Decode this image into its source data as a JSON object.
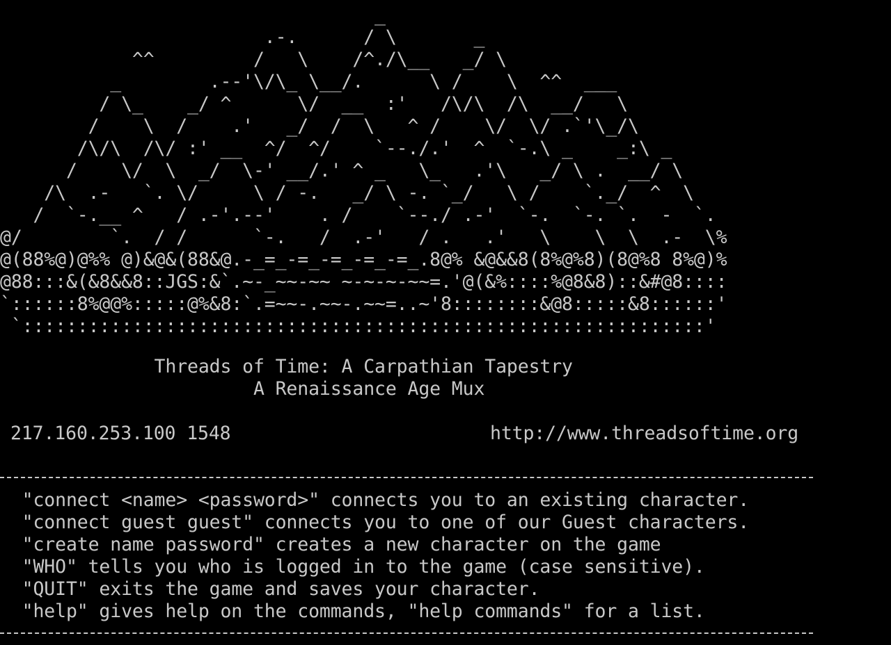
{
  "terminal": {
    "art_lines": [
      "                                  _",
      "                        .-.      / \\       _",
      "            ^^         /   \\    /^./\\__   _/ \\",
      "          _        .--'\\/\\_ \\__/.      \\ /    \\  ^^  ___",
      "         / \\_    _/ ^      \\/  __  :'   /\\/\\  /\\  __/   \\",
      "        /    \\  /    .'   _/  /  \\   ^ /    \\/  \\/ .`'\\_/\\",
      "       /\\/\\  /\\/ :' __  ^/  ^/    `--./.'  ^  `-.\\ _    _:\\ _",
      "      /    \\/  \\  _/  \\-' __/.' ^ _   \\_   .'\\   _/ \\ .  __/ \\",
      "    /\\  .-   `. \\/     \\ / -.   _/ \\ -. `_/   \\ /    `._/  ^  \\",
      "   /  `-.__ ^   / .-'.--'    . /    `--./ .-'  `-.  `-. `.  -  `.",
      "@/        `.  / /      `-.   /  .-'   / .   .'   \\    \\  \\  .-  \\%",
      "@(88%@)@%% @)&@&(88&@.-_=_-=_-=_-=_-=_.8@% &@&&8(8%@%8)(8@%8 8%@)%",
      "@88:::&(&8&&8::JGS:&`.~-_~~-~~ ~-~-~-~~=.'@(&%::::%@8&8)::&#@8::::",
      "`::::::8%@@%:::::@%&8:`.=~~-.~~-.~~=..~'8::::::::&@8:::::&8::::::'",
      " `::::::::::::::::::::::::::::::::::::::::::::::::::::::::::::::'"
    ],
    "title_line": "              Threads of Time: A Carpathian Tapestry",
    "subtitle_line": "                       A Renaissance Age Mux",
    "address": "217.160.253.100 1548",
    "url": "http://www.threadsoftime.org",
    "help_lines": [
      "  \"connect <name> <password>\" connects you to an existing character.",
      "  \"connect guest guest\" connects you to one of our Guest characters.",
      "  \"create name password\" creates a new character on the game",
      "  \"WHO\" tells you who is logged in to the game (case sensitive).",
      "  \"QUIT\" exits the game and saves your character.",
      "  \"help\" gives help on the commands, \"help commands\" for a list."
    ],
    "colors": {
      "background": "#000000",
      "foreground": "#c8c8c8"
    }
  }
}
